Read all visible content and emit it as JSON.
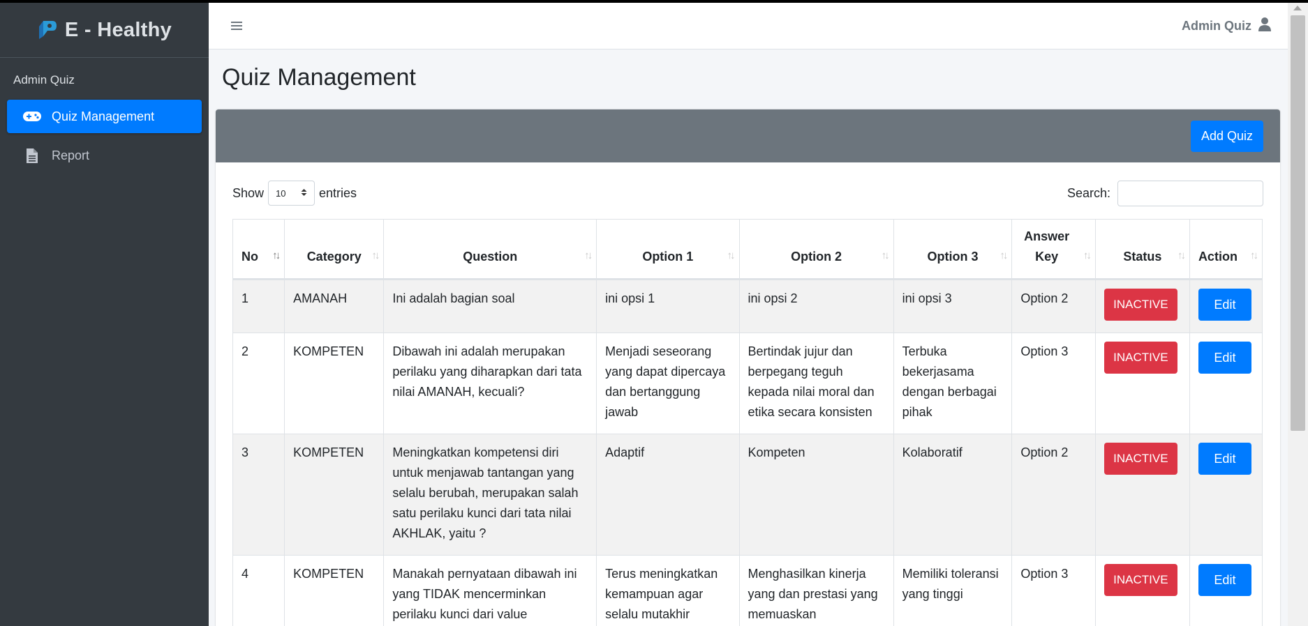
{
  "brand": {
    "name": "E - Healthy"
  },
  "sidebar": {
    "header": "Admin Quiz",
    "items": [
      {
        "label": "Quiz Management",
        "icon": "gamepad-icon",
        "active": true
      },
      {
        "label": "Report",
        "icon": "file-icon",
        "active": false
      }
    ]
  },
  "topbar": {
    "user": "Admin Quiz"
  },
  "page": {
    "title": "Quiz Management"
  },
  "toolbar": {
    "add_label": "Add Quiz"
  },
  "table_controls": {
    "show_label": "Show",
    "entries_value": "10",
    "entries_label": "entries",
    "search_label": "Search:",
    "search_value": ""
  },
  "table": {
    "columns": [
      "No",
      "Category",
      "Question",
      "Option 1",
      "Option 2",
      "Option 3",
      "Answer Key",
      "Status",
      "Action"
    ],
    "rows": [
      {
        "no": "1",
        "category": "AMANAH",
        "question": "Ini adalah bagian soal",
        "option1": "ini opsi 1",
        "option2": "ini opsi 2",
        "option3": "ini opsi 3",
        "answer": "Option 2",
        "status": "INACTIVE",
        "action": "Edit"
      },
      {
        "no": "2",
        "category": "KOMPETEN",
        "question": "Dibawah ini adalah merupakan perilaku yang diharapkan dari tata nilai AMANAH, kecuali?",
        "option1": "Menjadi seseorang yang dapat dipercaya dan bertanggung jawab",
        "option2": "Bertindak jujur dan berpegang teguh kepada nilai moral dan etika secara konsisten",
        "option3": "Terbuka bekerjasama dengan berbagai pihak",
        "answer": "Option 3",
        "status": "INACTIVE",
        "action": "Edit"
      },
      {
        "no": "3",
        "category": "KOMPETEN",
        "question": "Meningkatkan kompetensi diri untuk menjawab tantangan yang selalu berubah, merupakan salah satu perilaku kunci dari tata nilai AKHLAK, yaitu ?",
        "option1": "Adaptif",
        "option2": "Kompeten",
        "option3": "Kolaboratif",
        "answer": "Option 2",
        "status": "INACTIVE",
        "action": "Edit"
      },
      {
        "no": "4",
        "category": "KOMPETEN",
        "question": "Manakah pernyataan dibawah ini yang TIDAK mencerminkan perilaku kunci dari value",
        "option1": "Terus meningkatkan kemampuan agar selalu mutakhir",
        "option2": "Menghasilkan kinerja yang dan prestasi yang memuaskan",
        "option3": "Memiliki toleransi yang tinggi",
        "answer": "Option 3",
        "status": "INACTIVE",
        "action": "Edit"
      }
    ]
  },
  "colors": {
    "sidebar": "#343a40",
    "primary": "#007bff",
    "danger": "#dc3545",
    "card_header": "#6c757d"
  }
}
